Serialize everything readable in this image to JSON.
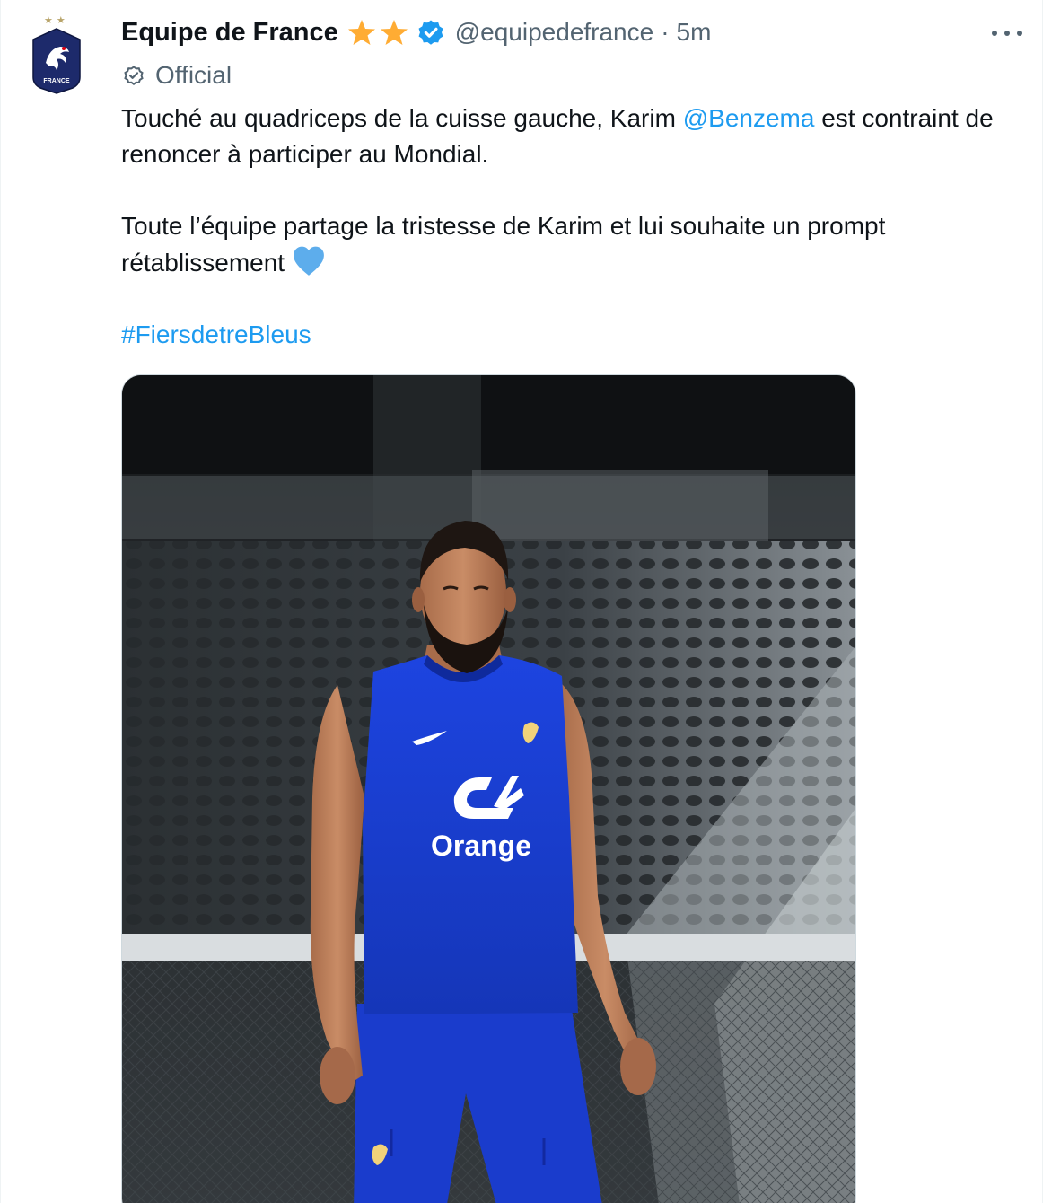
{
  "author": {
    "display_name": "Equipe de France",
    "handle": "@equipedefrance",
    "separator": "·",
    "time": "5m",
    "badge_label": "Official",
    "avatar_text": "FRANCE"
  },
  "tweet": {
    "line1_pre": "Touché au quadriceps de la cuisse gauche, Karim ",
    "mention": "@Benzema",
    "line1_post": " est contraint de renoncer à participer au Mondial.",
    "paragraph2": "Toute l’équipe partage la tristesse de Karim et lui souhaite un prompt rétablissement",
    "hashtag": "#FiersdetreBleus"
  },
  "media": {
    "sponsor_text": "Orange",
    "sponsor_logo_text": "CA"
  },
  "icons": {
    "more": "more-dots-icon",
    "verified": "verified-badge-icon",
    "official": "official-check-icon",
    "heart": "blue-heart-emoji",
    "star": "star-emoji"
  },
  "colors": {
    "link": "#1d9bf0",
    "secondary_text": "#536471",
    "primary_text": "#0f1419",
    "jersey_blue": "#1b3fd4",
    "avatar_navy": "#1d2a6b"
  }
}
